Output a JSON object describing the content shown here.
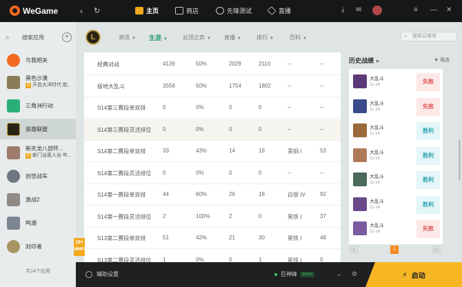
{
  "app": {
    "name": "WeGame"
  },
  "topnav": [
    {
      "label": "主页",
      "active": true,
      "icon": "home-icon",
      "color": "#f2a81d"
    },
    {
      "label": "商店",
      "active": false,
      "icon": "store-icon",
      "color": "#cccccc"
    },
    {
      "label": "先锋测试",
      "active": false,
      "icon": "pioneer-icon",
      "color": "#cccccc"
    },
    {
      "label": "直播",
      "active": false,
      "icon": "live-icon",
      "color": "#cccccc"
    }
  ],
  "sidebar": {
    "search_label": "搜索应用",
    "add": "+",
    "items": [
      {
        "label": "与我相关",
        "icon": "related-icon",
        "color": "#f26a21"
      },
      {
        "label": "黑色沙漠",
        "sub": "开启大洋时代 航...",
        "icon": "black-desert-icon",
        "color": "#8a7a56"
      },
      {
        "label": "三角洲行动",
        "icon": "delta-force-icon",
        "color": "#29b07a"
      },
      {
        "label": "英雄联盟",
        "icon": "lol-icon",
        "color": "#2a2416",
        "active": true
      },
      {
        "label": "新天龙八部怀...",
        "sub": "新门派恶人谷 年...",
        "icon": "tlbb-icon",
        "color": "#9c7b6a"
      },
      {
        "label": "创世战车",
        "icon": "crossout-icon",
        "color": "#6d7680"
      },
      {
        "label": "激战2",
        "icon": "gw2-icon",
        "color": "#8f8a84"
      },
      {
        "label": "鸣潮",
        "icon": "wuthering-icon",
        "color": "#7c8592"
      },
      {
        "label": "封印者",
        "icon": "closers-icon",
        "color": "#a79663"
      }
    ],
    "total": "共14个应用"
  },
  "subnav": {
    "tabs": [
      {
        "label": "资讯",
        "active": false
      },
      {
        "label": "生涯",
        "active": true
      },
      {
        "label": "云顶之弈",
        "active": false
      },
      {
        "label": "直播",
        "active": false
      },
      {
        "label": "排行",
        "active": false
      },
      {
        "label": "百科",
        "active": false
      }
    ],
    "logo_text": "L",
    "search_placeholder": "搜索召唤师"
  },
  "table": {
    "rows": [
      {
        "name": "经典对战",
        "games": "4139",
        "winrate": "50%",
        "kills": "2029",
        "deaths": "2110",
        "rank": "--",
        "last": "--"
      },
      {
        "name": "极地大乱斗",
        "games": "3556",
        "winrate": "50%",
        "kills": "1754",
        "deaths": "1802",
        "rank": "--",
        "last": "--"
      },
      {
        "name": "S14第三赛段单双排",
        "games": "0",
        "winrate": "0%",
        "kills": "0",
        "deaths": "0",
        "rank": "--",
        "last": "--"
      },
      {
        "name": "S14第三赛段灵活排位",
        "games": "0",
        "winrate": "0%",
        "kills": "0",
        "deaths": "0",
        "rank": "--",
        "last": "--"
      },
      {
        "name": "S14第二赛段单双排",
        "games": "33",
        "winrate": "43%",
        "kills": "14",
        "deaths": "19",
        "rank": "青铜 I",
        "last": "53"
      },
      {
        "name": "S14第二赛段灵活排位",
        "games": "0",
        "winrate": "0%",
        "kills": "0",
        "deaths": "0",
        "rank": "--",
        "last": "--"
      },
      {
        "name": "S14第一赛段单双排",
        "games": "44",
        "winrate": "60%",
        "kills": "26",
        "deaths": "18",
        "rank": "白银 IV",
        "last": "92"
      },
      {
        "name": "S14第一赛段灵活排位",
        "games": "2",
        "winrate": "100%",
        "kills": "2",
        "deaths": "0",
        "rank": "黑铁 I",
        "last": "37"
      },
      {
        "name": "S13第二赛段单双排",
        "games": "51",
        "winrate": "42%",
        "kills": "21",
        "deaths": "30",
        "rank": "黑铁 I",
        "last": "48"
      },
      {
        "name": "S13第二赛段灵活排位",
        "games": "1",
        "winrate": "0%",
        "kills": "0",
        "deaths": "1",
        "rank": "黑铁 I",
        "last": "0"
      }
    ]
  },
  "history": {
    "title": "历史战绩",
    "filter": "筛选",
    "matches": [
      {
        "mode": "大乱斗",
        "time": "11-14",
        "result": "失败",
        "win": false,
        "champ_color": "#5a3a7a"
      },
      {
        "mode": "大乱斗",
        "time": "11-14",
        "result": "失败",
        "win": false,
        "champ_color": "#3a4a8a"
      },
      {
        "mode": "大乱斗",
        "time": "11-14",
        "result": "胜利",
        "win": true,
        "champ_color": "#9a6a3a"
      },
      {
        "mode": "大乱斗",
        "time": "11-14",
        "result": "胜利",
        "win": true,
        "champ_color": "#b07a5a"
      },
      {
        "mode": "大乱斗",
        "time": "11-14",
        "result": "胜利",
        "win": true,
        "champ_color": "#4a6a5a"
      },
      {
        "mode": "大乱斗",
        "time": "11-14",
        "result": "胜利",
        "win": true,
        "champ_color": "#6a4a8a"
      },
      {
        "mode": "大乱斗",
        "time": "11-14",
        "result": "失败",
        "win": false,
        "champ_color": "#7a5aa0"
      }
    ],
    "page": "1",
    "prev": "‹",
    "next": "›"
  },
  "bottombar": {
    "helper": "辅助设置",
    "server": "巨神峰",
    "ping": "21ms",
    "launch": "启动"
  },
  "age_badge": {
    "line1": "16+",
    "line2": "适龄提示"
  }
}
